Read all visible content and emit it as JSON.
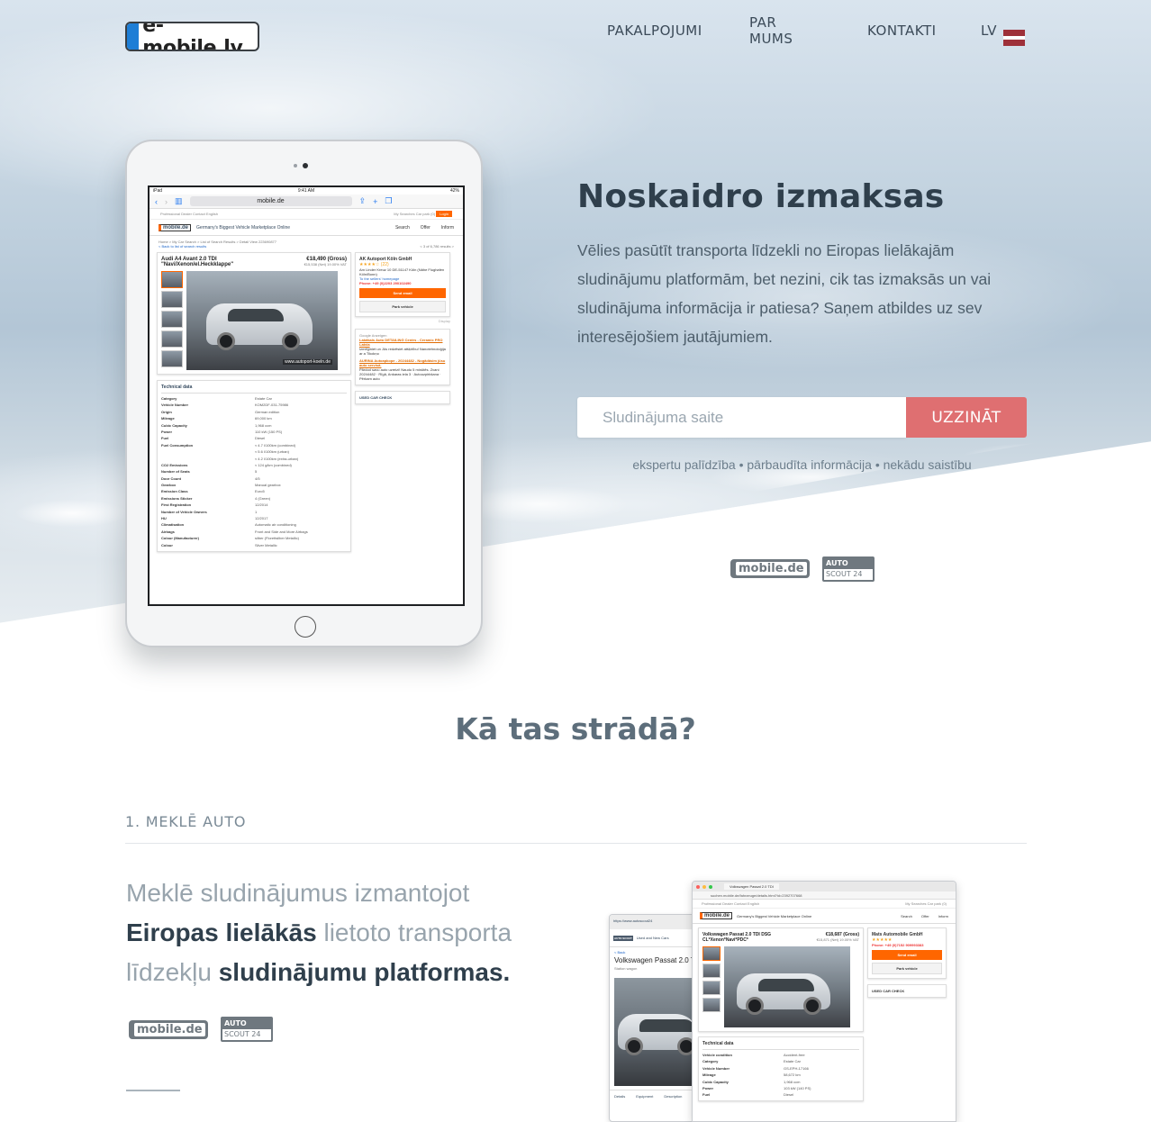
{
  "header": {
    "logo_text": "e-mobile.lv",
    "nav": [
      "PAKALPOJUMI",
      "PAR MUMS",
      "KONTAKTI",
      "LV"
    ]
  },
  "hero": {
    "title": "Noskaidro izmaksas",
    "text": "Vēlies pasūtīt transporta līdzekli no Eiropas lielākajām sludinājumu platformām, bet nezini, cik tas izmaksās un vai sludinājuma informācija ir patiesa? Saņem atbildes uz sev interesējošiem jautājumiem.",
    "search_placeholder": "Sludinājuma saite",
    "button": "UZZINĀT",
    "tagline": "ekspertu palīdzība • pārbaudīta informācija • nekādu saistību",
    "brand_mobile": "mobile.de",
    "brand_scout_top": "AUTO",
    "brand_scout_bottom": "SCOUT 24"
  },
  "tablet": {
    "status_left": "iPad",
    "status_time": "9:41 AM",
    "status_right": "42%",
    "url": "mobile.de",
    "top_links": "Professional Dealer   Contact   English",
    "top_right": "My Searches   Car park (0)",
    "login": "Login",
    "site_logo": "mobile.de",
    "site_slogan": "Germany's Biggest Vehicle Marketplace Online",
    "menu": [
      "Search",
      "Offer",
      "Inform"
    ],
    "crumbs": "Home > My Car Search > List of Search Results > Detail View 223690877",
    "back": "< Back to list of search results",
    "results": "< 3 of 6,786 results >",
    "ad_title": "Audi A4 Avant 2.0 TDI \"Navi/Xenon/el.Heckklappe\"",
    "ad_price": "€18,490 (Gross)",
    "ad_net": "€15,538 (Net) 19.00% VAT",
    "photo_web": "www.autoport-koeln.de",
    "tech_title": "Technical data",
    "tech_rows": [
      [
        "Category",
        "Estate Car"
      ],
      [
        "Vehicle Number",
        "KOM2DF-031-75986"
      ],
      [
        "Origin",
        "German edition"
      ],
      [
        "Mileage",
        "69,000 km"
      ],
      [
        "Cubic Capacity",
        "1,968 ccm"
      ],
      [
        "Power",
        "110 kW (150 PS)"
      ],
      [
        "Fuel",
        "Diesel"
      ],
      [
        "Fuel Consumption",
        "≈ 4.7 l/100km (combined)"
      ],
      [
        "",
        "≈ 5.6 l/100km (urban)"
      ],
      [
        "",
        "≈ 4.2 l/100km (extra-urban)"
      ],
      [
        "CO2 Emissions",
        "≈ 124 g/km (combined)"
      ],
      [
        "Number of Seats",
        "5"
      ],
      [
        "Door Count",
        "4/5"
      ],
      [
        "Gearbox",
        "Manual gearbox"
      ],
      [
        "Emission Class",
        "Euro5"
      ],
      [
        "Emissions Sticker",
        "4 (Green)"
      ],
      [
        "First Registration",
        "12/2014"
      ],
      [
        "Number of Vehicle Owners",
        "1"
      ],
      [
        "HU",
        "12/2017"
      ],
      [
        "Climatisation",
        "Automatic air conditioning"
      ],
      [
        "Airbags",
        "Front and Side and More Airbags"
      ],
      [
        "Colour (Manufacturer)",
        "silber (Florettsilber Metallic)"
      ],
      [
        "Colour",
        "Silver Metallic"
      ]
    ],
    "dealer_name": "AK Autoport Köln GmbH",
    "dealer_reviews": "★★★★☆ (22)",
    "dealer_address": "Am Linder Kreuz 10 DE-51147 Köln (Nähe Flughafen Köln/Bonn)",
    "dealer_link": "To the sellers' homepage",
    "dealer_phone": "Phone: +49 (0)2203 290102490",
    "send_email": "Send email",
    "park_vehicle": "Park vehicle",
    "display": "Display",
    "google_ads": "Google Anzeigen",
    "ad1_title": "Labākais Auto DETAILING Centrs - Ceramic PRO Latvia",
    "ad1_text": "Izmēģiniet un Jūs redzēsiet atšķirību! Nanotehnoloģija ar a Tikokņo",
    "ad2_title": "AURINA Autoapkope - 20244482 - Nogādāsim jūsu auto servisā.",
    "ad2_text": "Pārdod savu auto uzreizi! Naudu 5 minūtēs. Zvani 20244482 · Rīgā, Ankaras iela 3 · Autouzpirkšana · Pērkam auto",
    "used_car_check": "USED CAR CHECK"
  },
  "how": {
    "title": "Kā tas strādā?",
    "step_label": "1. MEKLĒ AUTO",
    "text_p1": "Meklē sludinājumus izmantojot ",
    "text_b1": "Eiropas lielākās",
    "text_p2": " lietoto transporta līdzekļu ",
    "text_b2": "sludinājumu platformas.",
    "brand_mobile": "mobile.de",
    "brand_scout_top": "AUTO",
    "brand_scout_bottom": "SCOUT 24"
  },
  "screens": {
    "phone_url": "https://www.autoscout24",
    "phone_header": "Used and New Cars",
    "phone_back": "< Back",
    "phone_title": "Volkswagen Passat 2.0 T",
    "phone_sub": "Station wagon",
    "phone_tabs": [
      "Details",
      "Equipment",
      "Description"
    ],
    "browser_tab": "Volkswagen Passat 2.0 TDI",
    "browser_url": "suchen.mobile.de/fahrzeuge/details.html?id=2392707668",
    "browser_title": "Volkswagen Passat 2.0 TDI DSG CL*Xenon*Navi*PDC*",
    "browser_price": "€18,687 (Gross)",
    "browser_net": "€15,871 (Net) 19.00% VAT",
    "browser_dealer": "Mats Automobile GmbH",
    "browser_phone": "Phone: +49 (0)7152 909993383",
    "browser_tech": [
      [
        "Vehicle condition",
        "Accident-free"
      ],
      [
        "Category",
        "Estate Car"
      ],
      [
        "Vehicle Number",
        "GS-EPH-17166"
      ],
      [
        "Mileage",
        "58,672 km"
      ],
      [
        "Cubic Capacity",
        "1,968 ccm"
      ],
      [
        "Power",
        "103 kW (140 PS)"
      ],
      [
        "Fuel",
        "Diesel"
      ]
    ]
  }
}
